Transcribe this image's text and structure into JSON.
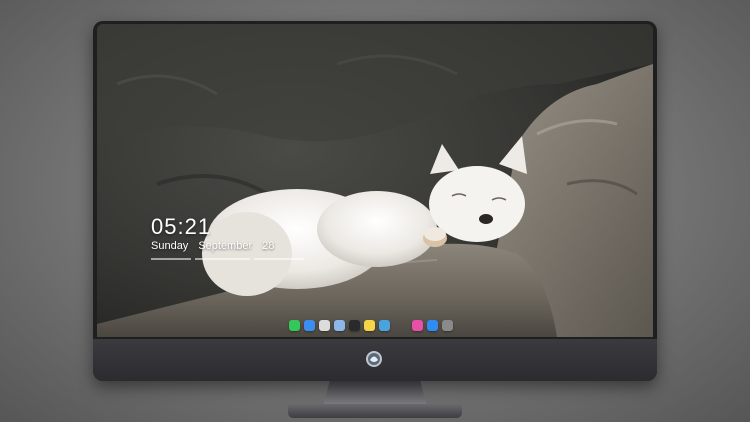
{
  "lock_screen": {
    "time": "05:21",
    "weekday": "Sunday",
    "month": "September",
    "day": "28",
    "subtitle_text": ""
  },
  "dock": {
    "apps": [
      {
        "icon": "messages-icon",
        "color": "#34c759"
      },
      {
        "icon": "finder-icon",
        "color": "#3b8ef0"
      },
      {
        "icon": "launchpad-icon",
        "color": "#dcdcdc"
      },
      {
        "icon": "preview-icon",
        "color": "#8bb8e8"
      },
      {
        "icon": "clapper-icon",
        "color": "#2a2a2a"
      },
      {
        "icon": "notes-icon",
        "color": "#f5d547"
      },
      {
        "icon": "photos-icon",
        "color": "#4aa3df"
      },
      {
        "icon": "itunes-icon",
        "color": "#e84fa8"
      },
      {
        "icon": "app-store-icon",
        "color": "#2f8cf2"
      },
      {
        "icon": "camera-icon",
        "color": "#8a8a8a"
      }
    ]
  },
  "colors": {
    "bezel": "#1f1f22",
    "chin": "#2f2f34",
    "background": "#7a7a7a"
  }
}
